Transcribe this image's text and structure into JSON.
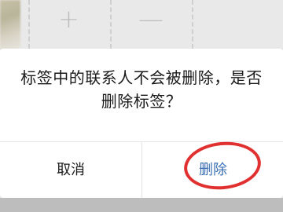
{
  "background": {
    "icons": {
      "add": {
        "glyph": "+",
        "icon": "plus-icon"
      },
      "remove": {
        "glyph": "—",
        "icon": "minus-icon"
      }
    }
  },
  "dialog": {
    "message_line1": "标签中的联系人不会被删除，是否",
    "message_line2": "删除标签？",
    "cancel_label": "取消",
    "delete_label": "删除"
  },
  "colors": {
    "delete_accent": "#3a6fb3",
    "annotation_circle": "#e03030",
    "text": "#1a1a1a"
  }
}
